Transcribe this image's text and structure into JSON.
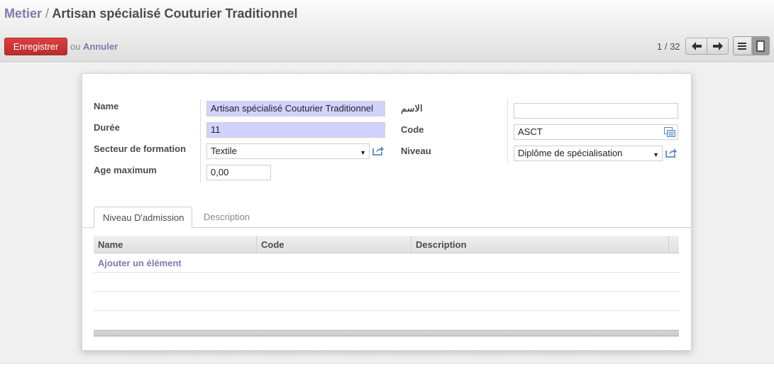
{
  "breadcrumb": {
    "parent": "Metier",
    "separator": "/",
    "current": "Artisan spécialisé Couturier Traditionnel"
  },
  "toolbar": {
    "save_label": "Enregistrer",
    "or_label": "ou",
    "cancel_label": "Annuler"
  },
  "pager": {
    "label": "1 / 32",
    "prev_icon": "arrow-left-icon",
    "next_icon": "arrow-right-icon"
  },
  "view_switcher": {
    "list_icon": "list-view-icon",
    "form_icon": "form-view-icon",
    "active": "form"
  },
  "form": {
    "left": [
      {
        "label": "Name",
        "value": "Artisan spécialisé Couturier Traditionnel",
        "required": true
      },
      {
        "label": "Durée",
        "value": "11",
        "required": true
      },
      {
        "label": "Secteur de formation",
        "value": "Textile",
        "type": "select"
      },
      {
        "label": "Age maximum",
        "value": "0,00"
      }
    ],
    "right": [
      {
        "label": "الاسم",
        "value": ""
      },
      {
        "label": "Code",
        "value": "ASCT"
      },
      {
        "label": "Niveau",
        "value": "Diplôme de spécialisation",
        "type": "select"
      }
    ]
  },
  "tabs": [
    {
      "label": "Niveau D'admission",
      "active": true
    },
    {
      "label": "Description",
      "active": false
    }
  ],
  "grid": {
    "columns": [
      "Name",
      "Code",
      "Description"
    ],
    "add_item_label": "Ajouter un élément",
    "rows": []
  },
  "colors": {
    "save_button": "#c43434",
    "link": "#7c7bad",
    "required_field": "#d2d2ff"
  }
}
